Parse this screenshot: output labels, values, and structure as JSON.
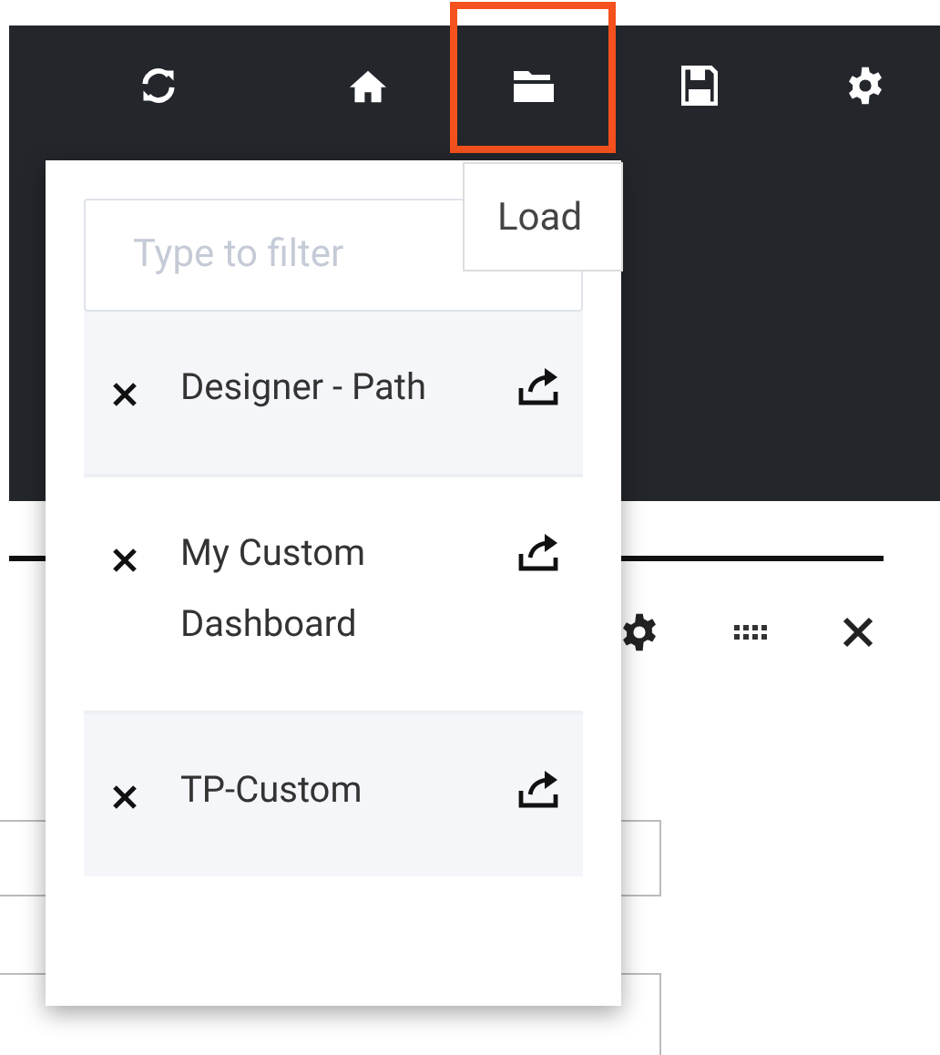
{
  "toolbar": {
    "buttons": [
      {
        "kind": "refresh",
        "highlighted": false
      },
      {
        "kind": "home",
        "highlighted": false
      },
      {
        "kind": "folder",
        "highlighted": true
      },
      {
        "kind": "save",
        "highlighted": false
      },
      {
        "kind": "settings",
        "highlighted": false
      }
    ]
  },
  "tooltip": {
    "text": "Load"
  },
  "load_menu": {
    "filter": {
      "placeholder": "Type to filter"
    },
    "items": [
      {
        "label": "Designer - Path"
      },
      {
        "label": "My Custom Dashboard"
      },
      {
        "label": "TP-Custom"
      }
    ]
  }
}
